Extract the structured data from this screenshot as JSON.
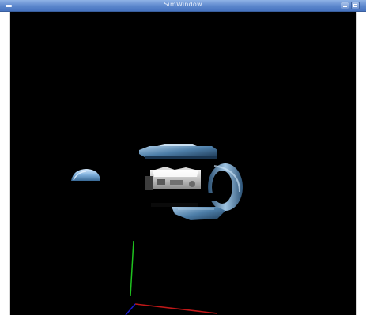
{
  "window": {
    "title": "SimWindow",
    "menu_icon": "window-menu-icon",
    "controls": [
      "minimize-icon",
      "maximize-icon"
    ]
  },
  "scene": {
    "background": "#000000",
    "axis_colors": {
      "x": "#c01818",
      "y": "#1fc21f",
      "z": "#1a1ad0"
    },
    "object_tint": "#6f9fc8"
  }
}
